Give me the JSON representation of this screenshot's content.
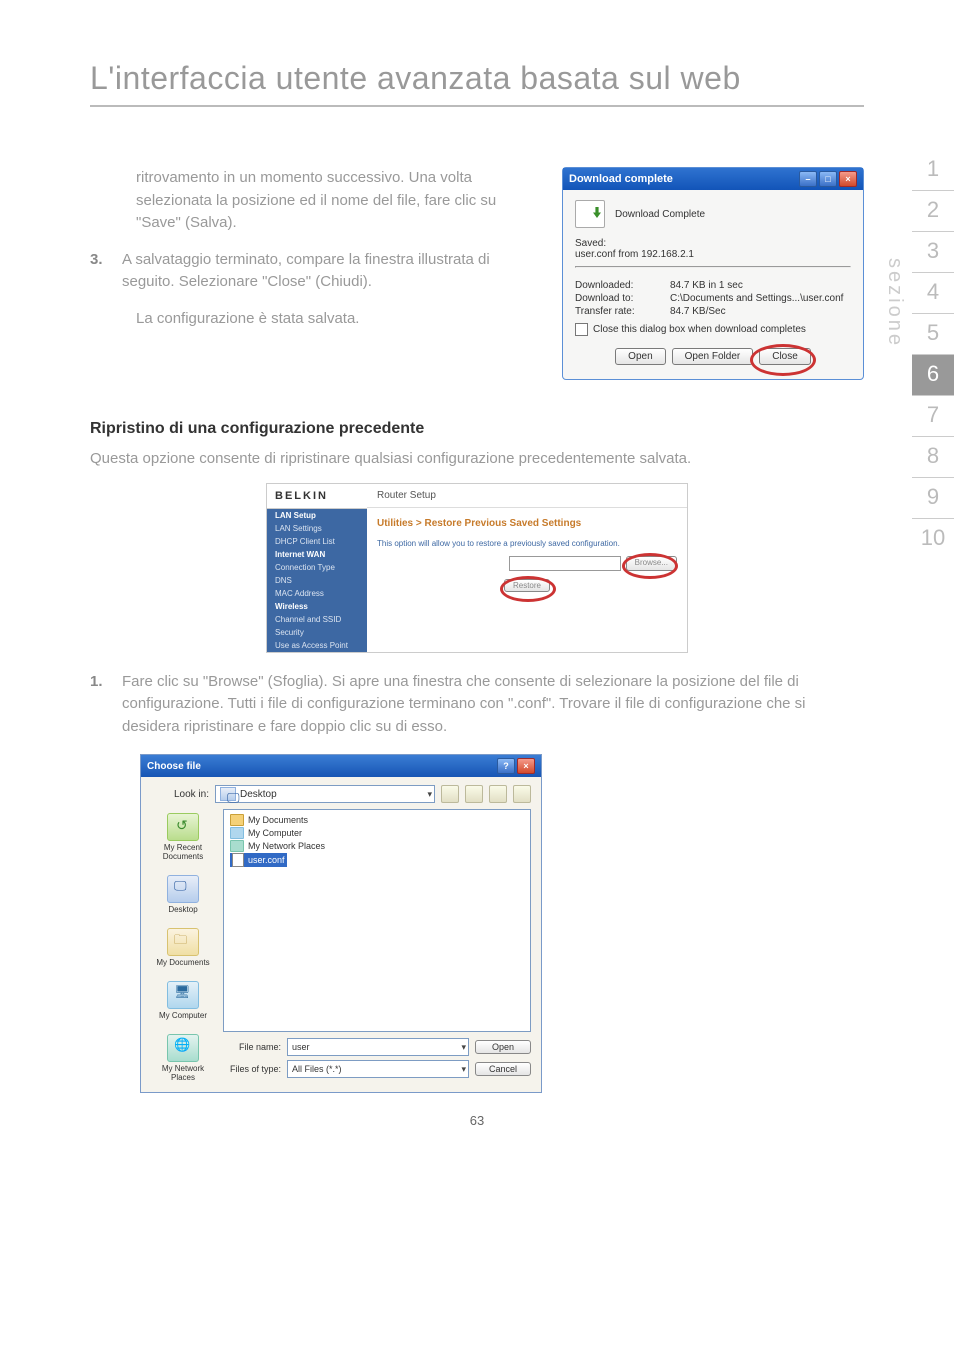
{
  "page_title": "L'interfaccia utente avanzata basata sul web",
  "intro_para": "ritrovamento in un momento successivo. Una volta selezionata la posizione ed il nome del file, fare clic su \"Save\" (Salva).",
  "step3_num": "3.",
  "step3_text": "A salvataggio terminato, compare la finestra illustrata di seguito. Selezionare \"Close\" (Chiudi).",
  "step3_note": "La configurazione è stata salvata.",
  "download": {
    "title": "Download complete",
    "header_text": "Download Complete",
    "saved_label": "Saved:",
    "saved_value": "user.conf from 192.168.2.1",
    "downloaded_label": "Downloaded:",
    "downloaded_value": "84.7 KB in 1 sec",
    "download_to_label": "Download to:",
    "download_to_value": "C:\\Documents and Settings...\\user.conf",
    "transfer_rate_label": "Transfer rate:",
    "transfer_rate_value": "84.7 KB/Sec",
    "checkbox_label": "Close this dialog box when download completes",
    "btn_open": "Open",
    "btn_open_folder": "Open Folder",
    "btn_close": "Close"
  },
  "restore_heading": "Ripristino di una configurazione precedente",
  "restore_desc": "Questa opzione consente di ripristinare qualsiasi configurazione precedentemente salvata.",
  "belkin": {
    "brand": "BELKIN",
    "router_setup": "Router Setup",
    "side_lan_setup": "LAN Setup",
    "side_lan_settings": "LAN Settings",
    "side_dhcp": "DHCP Client List",
    "side_internet_wan": "Internet WAN",
    "side_connection": "Connection Type",
    "side_dns": "DNS",
    "side_mac": "MAC Address",
    "side_wireless": "Wireless",
    "side_channel": "Channel and SSID",
    "side_security_w": "Security",
    "side_use_ap": "Use as Access Point",
    "section_title": "Utilities > Restore Previous Saved Settings",
    "desc": "This option will allow you to restore a previously saved configuration.",
    "browse_btn": "Browse...",
    "restore_btn": "Restore"
  },
  "step1_num": "1.",
  "step1_text": "Fare clic su \"Browse\" (Sfoglia). Si apre una finestra che consente di selezionare la posizione del file di configurazione. Tutti i file di configurazione terminano con \".conf\". Trovare il file di configurazione che si desidera ripristinare e fare doppio clic su di esso.",
  "choose_file": {
    "title": "Choose file",
    "look_in_label": "Look in:",
    "look_in_value": "Desktop",
    "side_recent": "My Recent Documents",
    "side_desktop": "Desktop",
    "side_docs": "My Documents",
    "side_computer": "My Computer",
    "side_network": "My Network Places",
    "file_my_docs": "My Documents",
    "file_my_computer": "My Computer",
    "file_my_network": "My Network Places",
    "file_selected": "user.conf",
    "file_name_label": "File name:",
    "file_name_value": "user",
    "file_type_label": "Files of type:",
    "file_type_value": "All Files (*.*)",
    "btn_open": "Open",
    "btn_cancel": "Cancel"
  },
  "side_tabs": [
    "1",
    "2",
    "3",
    "4",
    "5",
    "6",
    "7",
    "8",
    "9",
    "10"
  ],
  "side_label": "sezione",
  "page_number": "63"
}
